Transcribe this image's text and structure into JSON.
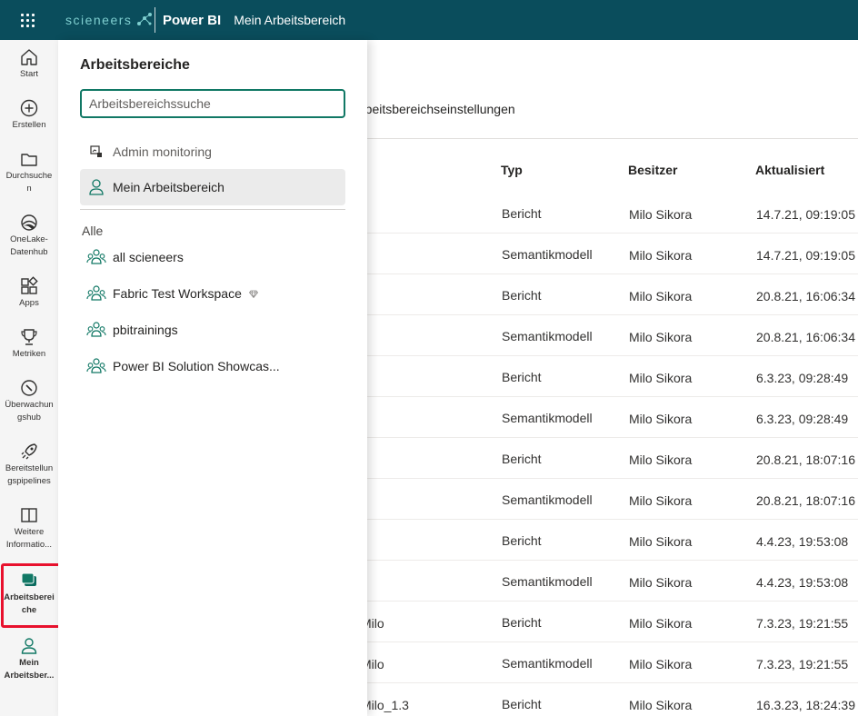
{
  "topbar": {
    "logo_text": "scieneers",
    "app_name": "Power BI",
    "workspace_name": "Mein Arbeitsbereich",
    "brand_color": "#0a4d5c"
  },
  "nav": {
    "items": [
      {
        "label": "Start",
        "icon": "home-icon"
      },
      {
        "label": "Erstellen",
        "icon": "plus-circle-icon"
      },
      {
        "label": "Durchsuchen",
        "icon": "folder-icon"
      },
      {
        "label": "OneLake-Datenhub",
        "icon": "onelake-icon"
      },
      {
        "label": "Apps",
        "icon": "apps-icon"
      },
      {
        "label": "Metriken",
        "icon": "trophy-icon"
      },
      {
        "label": "Überwachungshub",
        "icon": "monitor-icon"
      },
      {
        "label": "Bereitstellungspipelines",
        "icon": "rocket-icon"
      },
      {
        "label": "Weitere Informatio...",
        "icon": "book-icon"
      },
      {
        "label": "Arbeitsbereiche",
        "icon": "workspaces-icon"
      },
      {
        "label": "Mein Arbeitsber...",
        "icon": "person-icon"
      }
    ],
    "label_lines": [
      [
        "Start"
      ],
      [
        "Erstellen"
      ],
      [
        "Durchsuche",
        "n"
      ],
      [
        "OneLake-",
        "Datenhub"
      ],
      [
        "Apps"
      ],
      [
        "Metriken"
      ],
      [
        "Überwachun",
        "gshub"
      ],
      [
        "Bereitstellun",
        "gspipelines"
      ],
      [
        "Weitere",
        "Informatio..."
      ],
      [
        "Arbeitsberei",
        "che"
      ],
      [
        "Mein",
        "Arbeitsber..."
      ]
    ],
    "highlight_color": "#e8112d"
  },
  "flyout": {
    "title": "Arbeitsbereiche",
    "search_placeholder": "Arbeitsbereichssuche",
    "pinned": [
      {
        "label": "Admin monitoring",
        "icon": "admin-monitoring-icon"
      },
      {
        "label": "Mein Arbeitsbereich",
        "icon": "person-icon",
        "selected": true
      }
    ],
    "section_label": "Alle",
    "workspaces": [
      {
        "label": "all scieneers",
        "icon": "group-icon"
      },
      {
        "label": "Fabric Test Workspace",
        "icon": "group-icon",
        "badge": "premium-diamond-icon"
      },
      {
        "label": "pbitrainings",
        "icon": "group-icon"
      },
      {
        "label": "Power BI Solution Showcas...",
        "icon": "group-icon"
      }
    ],
    "accent_color": "#117865"
  },
  "content": {
    "settings_link": "rbeitsbereichseinstellungen",
    "columns": {
      "typ": "Typ",
      "besitzer": "Besitzer",
      "aktualisiert": "Aktualisiert"
    },
    "rows": [
      {
        "name": "",
        "typ": "Bericht",
        "besitzer": "Milo Sikora",
        "aktualisiert": "14.7.21, 09:19:05"
      },
      {
        "name": "",
        "typ": "Semantikmodell",
        "besitzer": "Milo Sikora",
        "aktualisiert": "14.7.21, 09:19:05"
      },
      {
        "name": "",
        "typ": "Bericht",
        "besitzer": "Milo Sikora",
        "aktualisiert": "20.8.21, 16:06:34"
      },
      {
        "name": "",
        "typ": "Semantikmodell",
        "besitzer": "Milo Sikora",
        "aktualisiert": "20.8.21, 16:06:34"
      },
      {
        "name": "",
        "typ": "Bericht",
        "besitzer": "Milo Sikora",
        "aktualisiert": "6.3.23, 09:28:49"
      },
      {
        "name": "",
        "typ": "Semantikmodell",
        "besitzer": "Milo Sikora",
        "aktualisiert": "6.3.23, 09:28:49"
      },
      {
        "name": "",
        "typ": "Bericht",
        "besitzer": "Milo Sikora",
        "aktualisiert": "20.8.21, 18:07:16"
      },
      {
        "name": "",
        "typ": "Semantikmodell",
        "besitzer": "Milo Sikora",
        "aktualisiert": "20.8.21, 18:07:16"
      },
      {
        "name": "",
        "typ": "Bericht",
        "besitzer": "Milo Sikora",
        "aktualisiert": "4.4.23, 19:53:08"
      },
      {
        "name": "",
        "typ": "Semantikmodell",
        "besitzer": "Milo Sikora",
        "aktualisiert": "4.4.23, 19:53:08"
      },
      {
        "name": "Milo",
        "typ": "Bericht",
        "besitzer": "Milo Sikora",
        "aktualisiert": "7.3.23, 19:21:55"
      },
      {
        "name": "Milo",
        "typ": "Semantikmodell",
        "besitzer": "Milo Sikora",
        "aktualisiert": "7.3.23, 19:21:55"
      },
      {
        "name": "Milo_1.3",
        "typ": "Bericht",
        "besitzer": "Milo Sikora",
        "aktualisiert": "16.3.23, 18:24:39"
      }
    ]
  }
}
